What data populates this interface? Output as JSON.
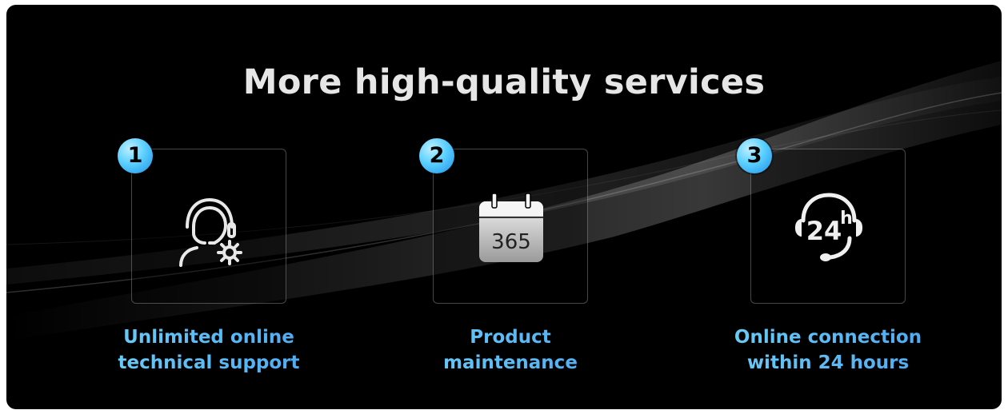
{
  "title": "More high-quality services",
  "services": [
    {
      "number": "1",
      "icon": "support-headset-gear-icon",
      "line1": "Unlimited online",
      "line2": "technical support"
    },
    {
      "number": "2",
      "icon": "calendar-365-icon",
      "icon_text": "365",
      "line1": "Product",
      "line2": "maintenance"
    },
    {
      "number": "3",
      "icon": "headset-24h-icon",
      "icon_text_main": "24",
      "icon_text_sup": "h",
      "line1": "Online connection",
      "line2": "within 24 hours"
    }
  ],
  "colors": {
    "background": "#000000",
    "title": "#e6e6e6",
    "label_start": "#6dd0f7",
    "label_end": "#4aa6f2",
    "badge": "#5ad0ff"
  }
}
